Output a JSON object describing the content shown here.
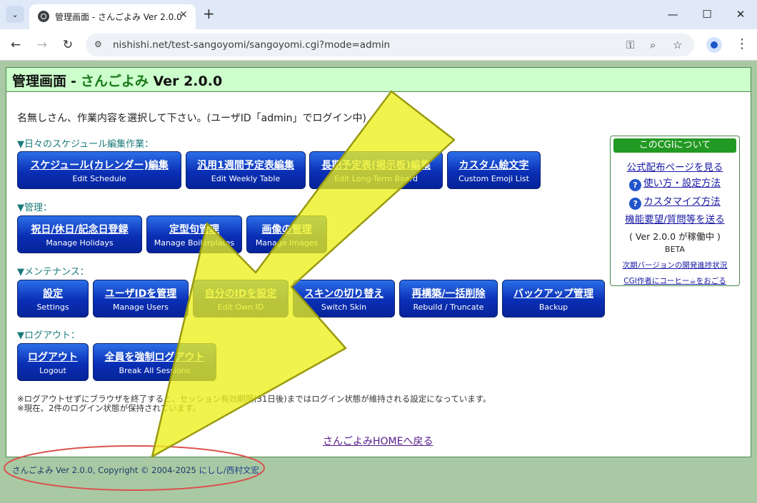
{
  "browser": {
    "tab_title": "管理画面 - さんごよみ Ver 2.0.0",
    "url": "nishishi.net/test-sangoyomi/sangoyomi.cgi?mode=admin"
  },
  "header": {
    "title": "管理画面",
    "dash": "-",
    "app_name": "さんごよみ",
    "version": "Ver 2.0.0"
  },
  "instruction": "名無しさん、作業内容を選択して下さい。(ユーザID「admin」でログイン中)",
  "sections": {
    "schedule": {
      "label": "▼日々のスケジュール編集作業：",
      "buttons": [
        {
          "jp": "スケジュール(カレンダー)編集",
          "en": "Edit Schedule"
        },
        {
          "jp": "汎用1週間予定表編集",
          "en": "Edit Weekly Table"
        },
        {
          "jp": "長期予定表(掲示板)編集",
          "en": "Edit Long-Term Board"
        },
        {
          "jp": "カスタム絵文字",
          "en": "Custom Emoji List"
        }
      ]
    },
    "manage": {
      "label": "▼管理：",
      "buttons": [
        {
          "jp": "祝日/休日/記念日登録",
          "en": "Manage Holidays"
        },
        {
          "jp": "定型句管理",
          "en": "Manage Boilerplates"
        },
        {
          "jp": "画像の管理",
          "en": "Manage Images"
        }
      ]
    },
    "maintenance": {
      "label": "▼メンテナンス：",
      "buttons": [
        {
          "jp": "設定",
          "en": "Settings"
        },
        {
          "jp": "ユーザIDを管理",
          "en": "Manage Users"
        },
        {
          "jp": "自分のIDを設定",
          "en": "Edit Own ID"
        },
        {
          "jp": "スキンの切り替え",
          "en": "Switch Skin"
        },
        {
          "jp": "再構築/一括削除",
          "en": "Rebuild / Truncate"
        },
        {
          "jp": "バックアップ管理",
          "en": "Backup"
        }
      ]
    },
    "logout": {
      "label": "▼ログアウト：",
      "buttons": [
        {
          "jp": "ログアウト",
          "en": "Logout"
        },
        {
          "jp": "全員を強制ログアウト",
          "en": "Break All Sessions"
        }
      ]
    }
  },
  "notes": [
    "※ログアウトせずにブラウザを終了すると、セッション有効期限(31日後)まではログイン状態が維持される設定になっています。",
    "※現在、2件のログイン状態が保持されています。"
  ],
  "home_link": "さんごよみHOMEへ戻る",
  "about": {
    "header": "このCGIについて",
    "official_link": "公式配布ページを見る",
    "usage_link": "使い方・設定方法",
    "customize_link": "カスタマイズ方法",
    "request_link": "機能要望/質問等を送る",
    "status": "( Ver 2.0.0 が稼働中 )",
    "beta": "BETA",
    "progress_link": "次期バージョンの開発進捗状況",
    "coffee_link": "CGI作者にコーヒー☕をおごる",
    "q_mark": "?"
  },
  "footer": {
    "text": "さんごよみ Ver 2.0.0, Copyright © 2004-2025 ",
    "author": "にしし/西村文宏",
    "period": "."
  },
  "colors": {
    "arrow": "#ecef1a",
    "ellipse": "#d9534f",
    "button_top": "#2c6fe8",
    "button_bottom": "#06239a"
  }
}
